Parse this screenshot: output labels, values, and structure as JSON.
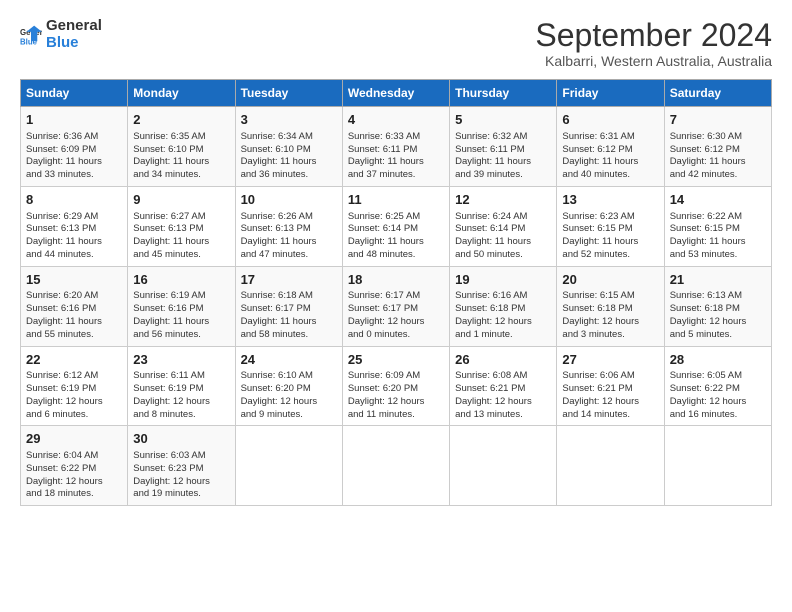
{
  "logo": {
    "general": "General",
    "blue": "Blue"
  },
  "title": "September 2024",
  "subtitle": "Kalbarri, Western Australia, Australia",
  "days_of_week": [
    "Sunday",
    "Monday",
    "Tuesday",
    "Wednesday",
    "Thursday",
    "Friday",
    "Saturday"
  ],
  "weeks": [
    [
      {
        "day": "1",
        "info": "Sunrise: 6:36 AM\nSunset: 6:09 PM\nDaylight: 11 hours\nand 33 minutes."
      },
      {
        "day": "2",
        "info": "Sunrise: 6:35 AM\nSunset: 6:10 PM\nDaylight: 11 hours\nand 34 minutes."
      },
      {
        "day": "3",
        "info": "Sunrise: 6:34 AM\nSunset: 6:10 PM\nDaylight: 11 hours\nand 36 minutes."
      },
      {
        "day": "4",
        "info": "Sunrise: 6:33 AM\nSunset: 6:11 PM\nDaylight: 11 hours\nand 37 minutes."
      },
      {
        "day": "5",
        "info": "Sunrise: 6:32 AM\nSunset: 6:11 PM\nDaylight: 11 hours\nand 39 minutes."
      },
      {
        "day": "6",
        "info": "Sunrise: 6:31 AM\nSunset: 6:12 PM\nDaylight: 11 hours\nand 40 minutes."
      },
      {
        "day": "7",
        "info": "Sunrise: 6:30 AM\nSunset: 6:12 PM\nDaylight: 11 hours\nand 42 minutes."
      }
    ],
    [
      {
        "day": "8",
        "info": "Sunrise: 6:29 AM\nSunset: 6:13 PM\nDaylight: 11 hours\nand 44 minutes."
      },
      {
        "day": "9",
        "info": "Sunrise: 6:27 AM\nSunset: 6:13 PM\nDaylight: 11 hours\nand 45 minutes."
      },
      {
        "day": "10",
        "info": "Sunrise: 6:26 AM\nSunset: 6:13 PM\nDaylight: 11 hours\nand 47 minutes."
      },
      {
        "day": "11",
        "info": "Sunrise: 6:25 AM\nSunset: 6:14 PM\nDaylight: 11 hours\nand 48 minutes."
      },
      {
        "day": "12",
        "info": "Sunrise: 6:24 AM\nSunset: 6:14 PM\nDaylight: 11 hours\nand 50 minutes."
      },
      {
        "day": "13",
        "info": "Sunrise: 6:23 AM\nSunset: 6:15 PM\nDaylight: 11 hours\nand 52 minutes."
      },
      {
        "day": "14",
        "info": "Sunrise: 6:22 AM\nSunset: 6:15 PM\nDaylight: 11 hours\nand 53 minutes."
      }
    ],
    [
      {
        "day": "15",
        "info": "Sunrise: 6:20 AM\nSunset: 6:16 PM\nDaylight: 11 hours\nand 55 minutes."
      },
      {
        "day": "16",
        "info": "Sunrise: 6:19 AM\nSunset: 6:16 PM\nDaylight: 11 hours\nand 56 minutes."
      },
      {
        "day": "17",
        "info": "Sunrise: 6:18 AM\nSunset: 6:17 PM\nDaylight: 11 hours\nand 58 minutes."
      },
      {
        "day": "18",
        "info": "Sunrise: 6:17 AM\nSunset: 6:17 PM\nDaylight: 12 hours\nand 0 minutes."
      },
      {
        "day": "19",
        "info": "Sunrise: 6:16 AM\nSunset: 6:18 PM\nDaylight: 12 hours\nand 1 minute."
      },
      {
        "day": "20",
        "info": "Sunrise: 6:15 AM\nSunset: 6:18 PM\nDaylight: 12 hours\nand 3 minutes."
      },
      {
        "day": "21",
        "info": "Sunrise: 6:13 AM\nSunset: 6:18 PM\nDaylight: 12 hours\nand 5 minutes."
      }
    ],
    [
      {
        "day": "22",
        "info": "Sunrise: 6:12 AM\nSunset: 6:19 PM\nDaylight: 12 hours\nand 6 minutes."
      },
      {
        "day": "23",
        "info": "Sunrise: 6:11 AM\nSunset: 6:19 PM\nDaylight: 12 hours\nand 8 minutes."
      },
      {
        "day": "24",
        "info": "Sunrise: 6:10 AM\nSunset: 6:20 PM\nDaylight: 12 hours\nand 9 minutes."
      },
      {
        "day": "25",
        "info": "Sunrise: 6:09 AM\nSunset: 6:20 PM\nDaylight: 12 hours\nand 11 minutes."
      },
      {
        "day": "26",
        "info": "Sunrise: 6:08 AM\nSunset: 6:21 PM\nDaylight: 12 hours\nand 13 minutes."
      },
      {
        "day": "27",
        "info": "Sunrise: 6:06 AM\nSunset: 6:21 PM\nDaylight: 12 hours\nand 14 minutes."
      },
      {
        "day": "28",
        "info": "Sunrise: 6:05 AM\nSunset: 6:22 PM\nDaylight: 12 hours\nand 16 minutes."
      }
    ],
    [
      {
        "day": "29",
        "info": "Sunrise: 6:04 AM\nSunset: 6:22 PM\nDaylight: 12 hours\nand 18 minutes."
      },
      {
        "day": "30",
        "info": "Sunrise: 6:03 AM\nSunset: 6:23 PM\nDaylight: 12 hours\nand 19 minutes."
      },
      {
        "day": "",
        "info": ""
      },
      {
        "day": "",
        "info": ""
      },
      {
        "day": "",
        "info": ""
      },
      {
        "day": "",
        "info": ""
      },
      {
        "day": "",
        "info": ""
      }
    ]
  ]
}
